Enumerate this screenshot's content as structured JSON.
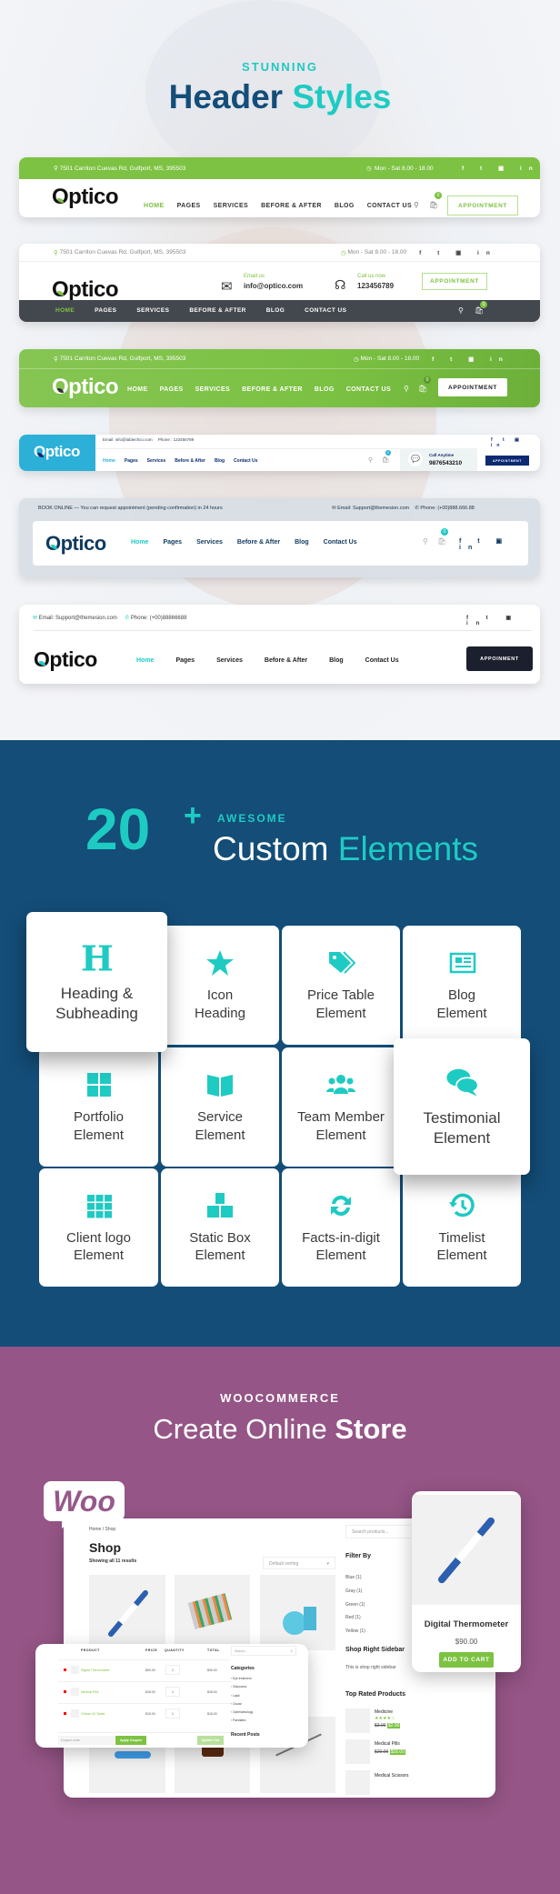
{
  "hero": {
    "kicker": "STUNNING",
    "title_a": "Header",
    "title_b": "Styles"
  },
  "headers": {
    "h1": {
      "address": "7501 Carriton Cuevas Rd, Gulfport, MS, 395503",
      "hours": "Mon - Sat 8.00 - 18.00",
      "logo": "Optico",
      "nav": [
        "HOME",
        "PAGES",
        "SERVICES",
        "BEFORE & AFTER",
        "BLOG",
        "CONTACT US"
      ],
      "cart_count": "0",
      "button": "APPOINTMENT"
    },
    "h2": {
      "address": "7501 Carriton Cuevas Rd, Gulfport, MS, 395503",
      "hours": "Mon - Sat 8.00 - 18.00",
      "logo": "Optico",
      "email_label": "Email us",
      "email": "info@optico.com",
      "call_label": "Call us now",
      "phone": "123456789",
      "button": "APPOINTMENT",
      "nav": [
        "HOME",
        "PAGES",
        "SERVICES",
        "BEFORE & AFTER",
        "BLOG",
        "CONTACT US"
      ],
      "cart_count": "0"
    },
    "h3": {
      "address": "7501 Carriton Cuevas Rd, Gulfport, MS, 395503",
      "hours": "Mon - Sat 8.00 - 18.00",
      "logo": "Optico",
      "nav": [
        "HOME",
        "PAGES",
        "SERVICES",
        "BEFORE & AFTER",
        "BLOG",
        "CONTACT US"
      ],
      "cart_count": "0",
      "button": "APPOINTMENT"
    },
    "h4": {
      "logo": "Optico",
      "email": "Email: info@labtechco.com",
      "phone": "Phone : 123456789",
      "nav": [
        "Home",
        "Pages",
        "Services",
        "Before & After",
        "Blog",
        "Contact Us"
      ],
      "cart_count": "0",
      "call_label": "Call Anytime",
      "call_number": "9876543210",
      "button": "APPOINTMENT"
    },
    "h5": {
      "book": "BOOK ONLINE",
      "notice": "You can request appointment (pending confirmation) in 24 hours",
      "email": "Email: Support@themesion.com",
      "phone": "Phone: (+00)888.666.88",
      "logo": "Optico",
      "nav": [
        "Home",
        "Pages",
        "Services",
        "Before & After",
        "Blog",
        "Contact Us"
      ],
      "cart_count": "0"
    },
    "h6": {
      "email": "Email: Support@themesion.com",
      "phone": "Phone: (+00)88866688",
      "logo": "Optico",
      "nav": [
        "Home",
        "Pages",
        "Services",
        "Before & After",
        "Blog",
        "Contact Us"
      ],
      "button": "APPOINMENT"
    }
  },
  "elements": {
    "count": "20",
    "plus": "+",
    "kicker": "AWESOME",
    "title_a": "Custom",
    "title_b": "Elements",
    "cards": [
      {
        "label1": "Heading &",
        "label2": "Subheading",
        "icon": "heading-icon"
      },
      {
        "label1": "Icon",
        "label2": "Heading",
        "icon": "star-icon"
      },
      {
        "label1": "Price Table",
        "label2": "Element",
        "icon": "tags-icon"
      },
      {
        "label1": "Blog",
        "label2": "Element",
        "icon": "newspaper-icon"
      },
      {
        "label1": "Portfolio",
        "label2": "Element",
        "icon": "grid-icon"
      },
      {
        "label1": "Service",
        "label2": "Element",
        "icon": "book-open-icon"
      },
      {
        "label1": "Team Member",
        "label2": "Element",
        "icon": "users-icon"
      },
      {
        "label1": "Testimonial",
        "label2": "Element",
        "icon": "comments-icon"
      },
      {
        "label1": "Client logo",
        "label2": "Element",
        "icon": "grid-small-icon"
      },
      {
        "label1": "Static Box",
        "label2": "Element",
        "icon": "boxes-icon"
      },
      {
        "label1": "Facts-in-digit",
        "label2": "Element",
        "icon": "sync-icon"
      },
      {
        "label1": "Timelist",
        "label2": "Element",
        "icon": "history-icon"
      }
    ],
    "accent": "#1ecbc3"
  },
  "store": {
    "kicker": "WOOCOMMERCE",
    "title_a": "Create Online",
    "title_b": "Store",
    "woo_logo": "Woo",
    "shop": {
      "breadcrumb": "Home / Shop",
      "title": "Shop",
      "results": "Showing all 11 results",
      "sorting": "Default sorting",
      "search": "Search products...",
      "filter_title": "Filter By",
      "filters": [
        "Blue (1)",
        "Gray (1)",
        "Green (1)",
        "Red (1)",
        "Yellow (1)"
      ],
      "sidebar_title": "Shop Right Sidebar",
      "sidebar_text": "This is shop right sidebar",
      "partial_title": "ttle",
      "top_rated_title": "Top Rated Products",
      "top_rated": [
        {
          "name": "Medicine",
          "old": "$3.00",
          "price": "$2.00",
          "rating": 4
        },
        {
          "name": "Medical Pills",
          "old": "$20.00",
          "price": "$16.00"
        },
        {
          "name": "Medical Scissors"
        }
      ]
    },
    "product": {
      "name": "Digital Thermometer",
      "price": "$90.00",
      "button": "ADD TO CART"
    },
    "cart": {
      "headers": [
        "PRODUCT",
        "PRICE",
        "QUANTITY",
        "TOTAL"
      ],
      "rows": [
        {
          "name": "Digital Thermometer",
          "price": "$90.00",
          "qty": "1",
          "total": "$90.00"
        },
        {
          "name": "Medical Pills",
          "price": "$18.00",
          "qty": "1",
          "total": "$18.00"
        },
        {
          "name": "Ortivan 40 Tablet",
          "price": "$15.00",
          "qty": "1",
          "total": "$15.00"
        }
      ],
      "coupon_placeholder": "Coupon code",
      "apply": "Apply Coupon",
      "update": "Update Cart",
      "search": "Search...",
      "categories_title": "Categories",
      "categories": [
        "Eye treatment",
        "Glaucoma",
        "Lasik",
        "Ocular",
        "Ophthalmology",
        "Paediatric"
      ],
      "recent_title": "Recent Posts"
    }
  },
  "colors": {
    "green": "#7dc242",
    "teal": "#1ecbc3",
    "navy": "#134d78",
    "purple": "#955586",
    "dark": "#43474e"
  }
}
